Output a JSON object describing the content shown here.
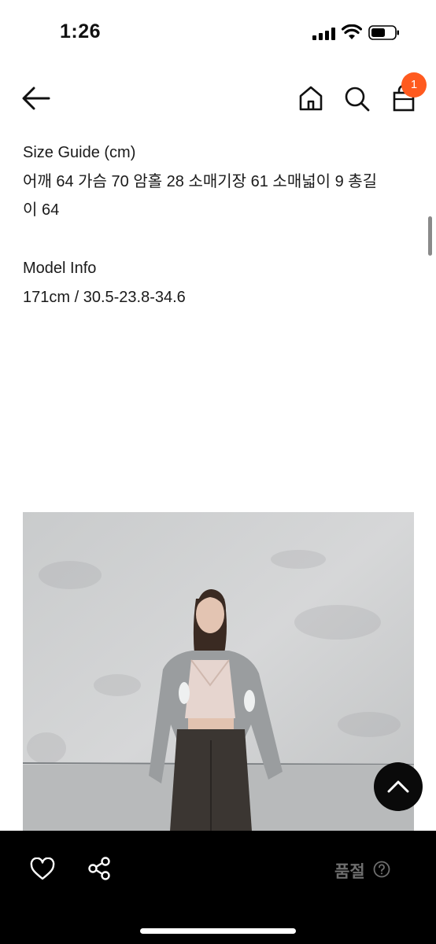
{
  "status_bar": {
    "time": "1:26"
  },
  "header": {
    "cart_count": "1"
  },
  "description": {
    "size_title": "Size Guide (cm)",
    "size_line1": "어깨 64 가슴 70 암홀 28 소매기장 61 소매넓이 9 총길",
    "size_line2": "이 64",
    "model_title": "Model Info",
    "model_value": "171cm / 30.5-23.8-34.6"
  },
  "bottom_bar": {
    "soldout_label": "품절"
  },
  "colors": {
    "accent": "#ff5a1f",
    "bar": "#000000"
  },
  "icons": [
    "back-arrow-icon",
    "home-icon",
    "search-icon",
    "cart-icon",
    "chevron-up-icon",
    "heart-icon",
    "share-icon",
    "question-icon"
  ]
}
